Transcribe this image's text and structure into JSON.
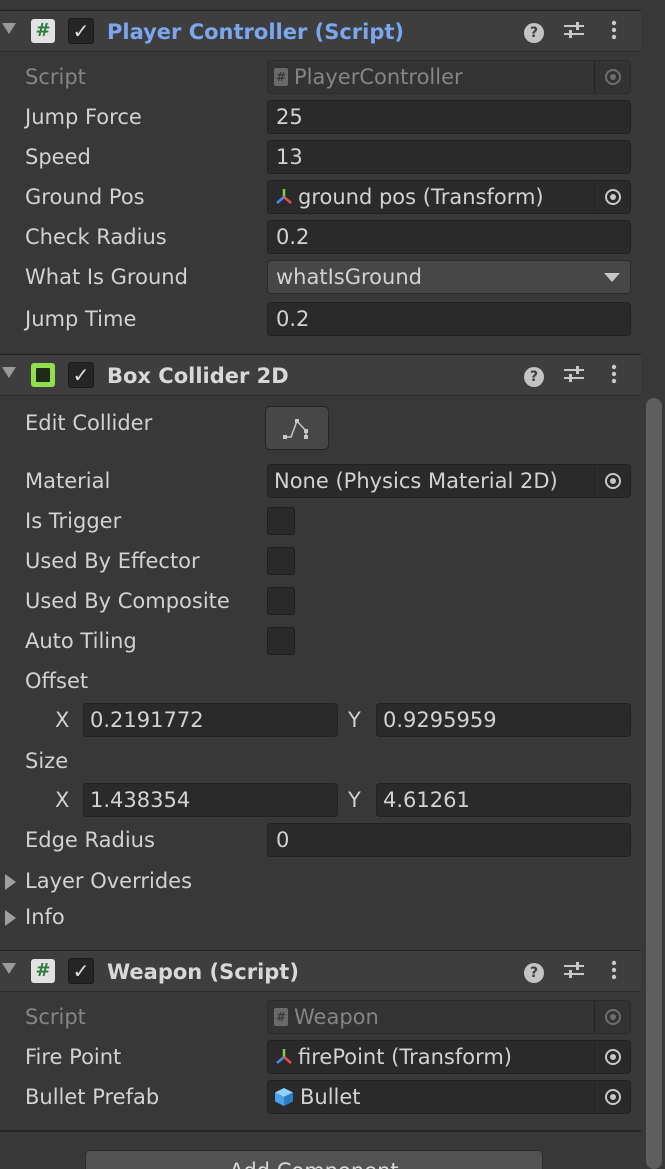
{
  "player_controller": {
    "title": "Player Controller (Script)",
    "fields": {
      "script_label": "Script",
      "script_value": "PlayerController",
      "jump_force_label": "Jump Force",
      "jump_force_value": "25",
      "speed_label": "Speed",
      "speed_value": "13",
      "ground_pos_label": "Ground Pos",
      "ground_pos_value": "ground pos  (Transform)",
      "check_radius_label": "Check Radius",
      "check_radius_value": "0.2",
      "what_is_ground_label": "What Is Ground",
      "what_is_ground_value": "whatIsGround",
      "jump_time_label": "Jump Time",
      "jump_time_value": "0.2"
    }
  },
  "box_collider": {
    "title": "Box Collider 2D",
    "edit_collider_label": "Edit Collider",
    "material_label": "Material",
    "material_value": "None (Physics Material 2D)",
    "is_trigger_label": "Is Trigger",
    "used_by_effector_label": "Used By Effector",
    "used_by_composite_label": "Used By Composite",
    "auto_tiling_label": "Auto Tiling",
    "offset_label": "Offset",
    "offset_x_label": "X",
    "offset_x": "0.2191772",
    "offset_y_label": "Y",
    "offset_y": "0.9295959",
    "size_label": "Size",
    "size_x_label": "X",
    "size_x": "1.438354",
    "size_y_label": "Y",
    "size_y": "4.61261",
    "edge_radius_label": "Edge Radius",
    "edge_radius_value": "0",
    "layer_overrides_label": "Layer Overrides",
    "info_label": "Info"
  },
  "weapon": {
    "title": "Weapon (Script)",
    "script_label": "Script",
    "script_value": "Weapon",
    "fire_point_label": "Fire Point",
    "fire_point_value": "firePoint (Transform)",
    "bullet_prefab_label": "Bullet Prefab",
    "bullet_prefab_value": "Bullet"
  },
  "add_component_label": "Add Component",
  "colors": {
    "background": "#383838",
    "header": "#3e3e3e",
    "field": "#2a2a2a",
    "script_title": "#7ba7f0",
    "box_collider_icon": "#8fe04d"
  }
}
